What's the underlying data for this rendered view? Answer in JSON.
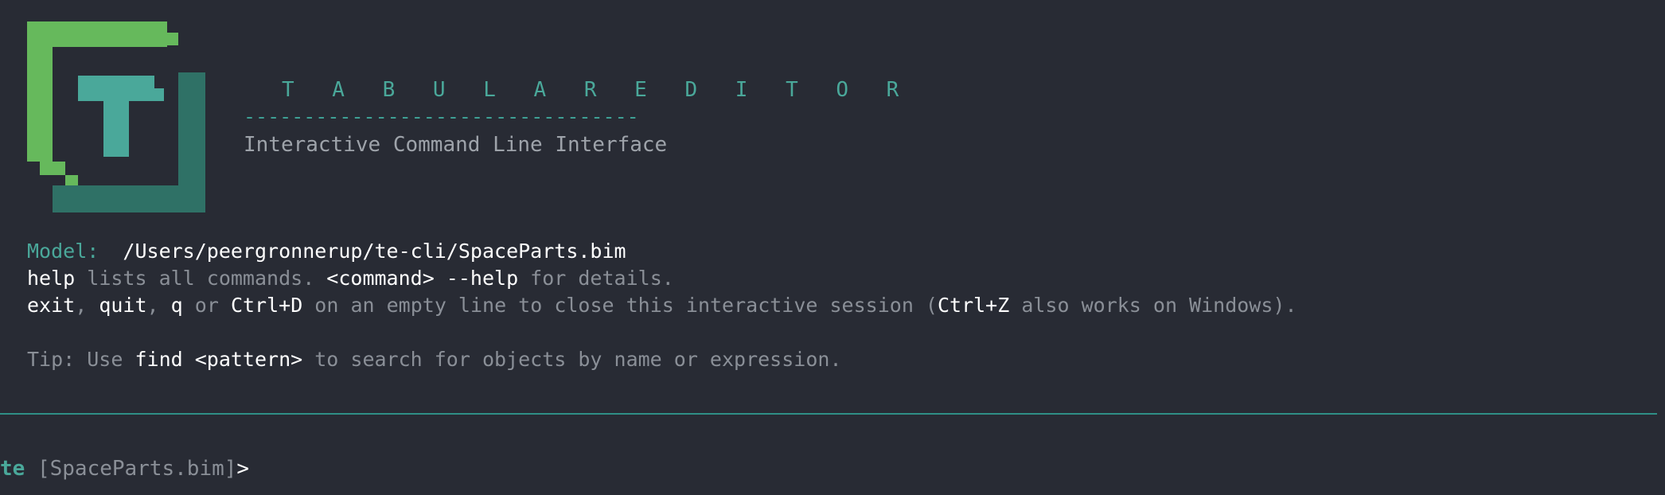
{
  "logo": {
    "colors": {
      "light_green": "#66b95c",
      "dark_teal": "#2f7166",
      "mid_teal": "#4aa89a",
      "background": "#282b34"
    }
  },
  "header": {
    "title": "T A B U L A R   E D I T O R",
    "separator": "---------------------------------",
    "subtitle": "Interactive Command Line Interface"
  },
  "info": {
    "model_label": "Model:",
    "model_path": "/Users/peergronnerup/te-cli/SpaceParts.bim",
    "help_cmd": "help",
    "help_text": " lists all commands. ",
    "command_placeholder": "<command> --help",
    "details_text": " for details.",
    "exit_cmd": "exit",
    "comma1": ", ",
    "quit_cmd": "quit",
    "comma2": ", ",
    "q_cmd": "q",
    "or_text": " or ",
    "ctrl_d": "Ctrl+D",
    "close_text": " on an empty line to close this interactive session (",
    "ctrl_z": "Ctrl+Z",
    "windows_text": " also works on Windows)."
  },
  "tip": {
    "prefix": "Tip: Use ",
    "command": "find <pattern>",
    "suffix": " to search for objects by name or expression."
  },
  "prompt": {
    "name": "te",
    "model": " [SpaceParts.bim]",
    "caret": ">"
  },
  "colors": {
    "background": "#282b34",
    "accent": "#4aa89a",
    "dim_text": "#8a8f97",
    "bright_text": "#ffffff",
    "separator": "#2f8f86"
  }
}
